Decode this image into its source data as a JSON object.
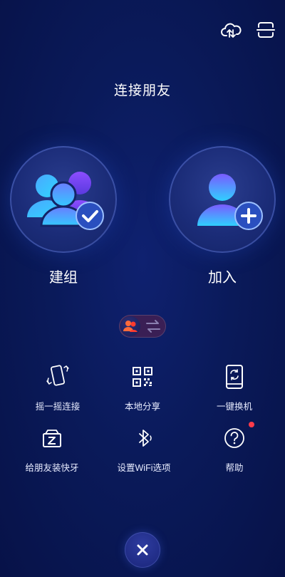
{
  "title": "连接朋友",
  "topbar": {
    "cloud_icon": "cloud-upload-icon",
    "menu_icon": "menu-icon"
  },
  "main_actions": [
    {
      "label": "建组",
      "icon": "group-check-icon"
    },
    {
      "label": "加入",
      "icon": "user-add-icon"
    }
  ],
  "mode_toggle": {
    "icon": "switch-mode-icon"
  },
  "options": [
    {
      "label": "摇一摇连接",
      "icon": "shake-phone-icon"
    },
    {
      "label": "本地分享",
      "icon": "qr-code-icon"
    },
    {
      "label": "一键换机",
      "icon": "phone-switch-icon"
    },
    {
      "label": "给朋友装快牙",
      "icon": "install-app-icon"
    },
    {
      "label": "设置WiFi选项",
      "icon": "bluetooth-icon"
    },
    {
      "label": "帮助",
      "icon": "help-icon",
      "badge": "red-dot"
    }
  ],
  "close_button": {
    "icon": "close-icon"
  },
  "colors": {
    "background": "#0a1a5a",
    "accent_blue": "#39c4ff",
    "accent_purple": "#8a4dff",
    "badge_red": "#ff3b4a",
    "toggle_orange": "#ff5a2e"
  }
}
